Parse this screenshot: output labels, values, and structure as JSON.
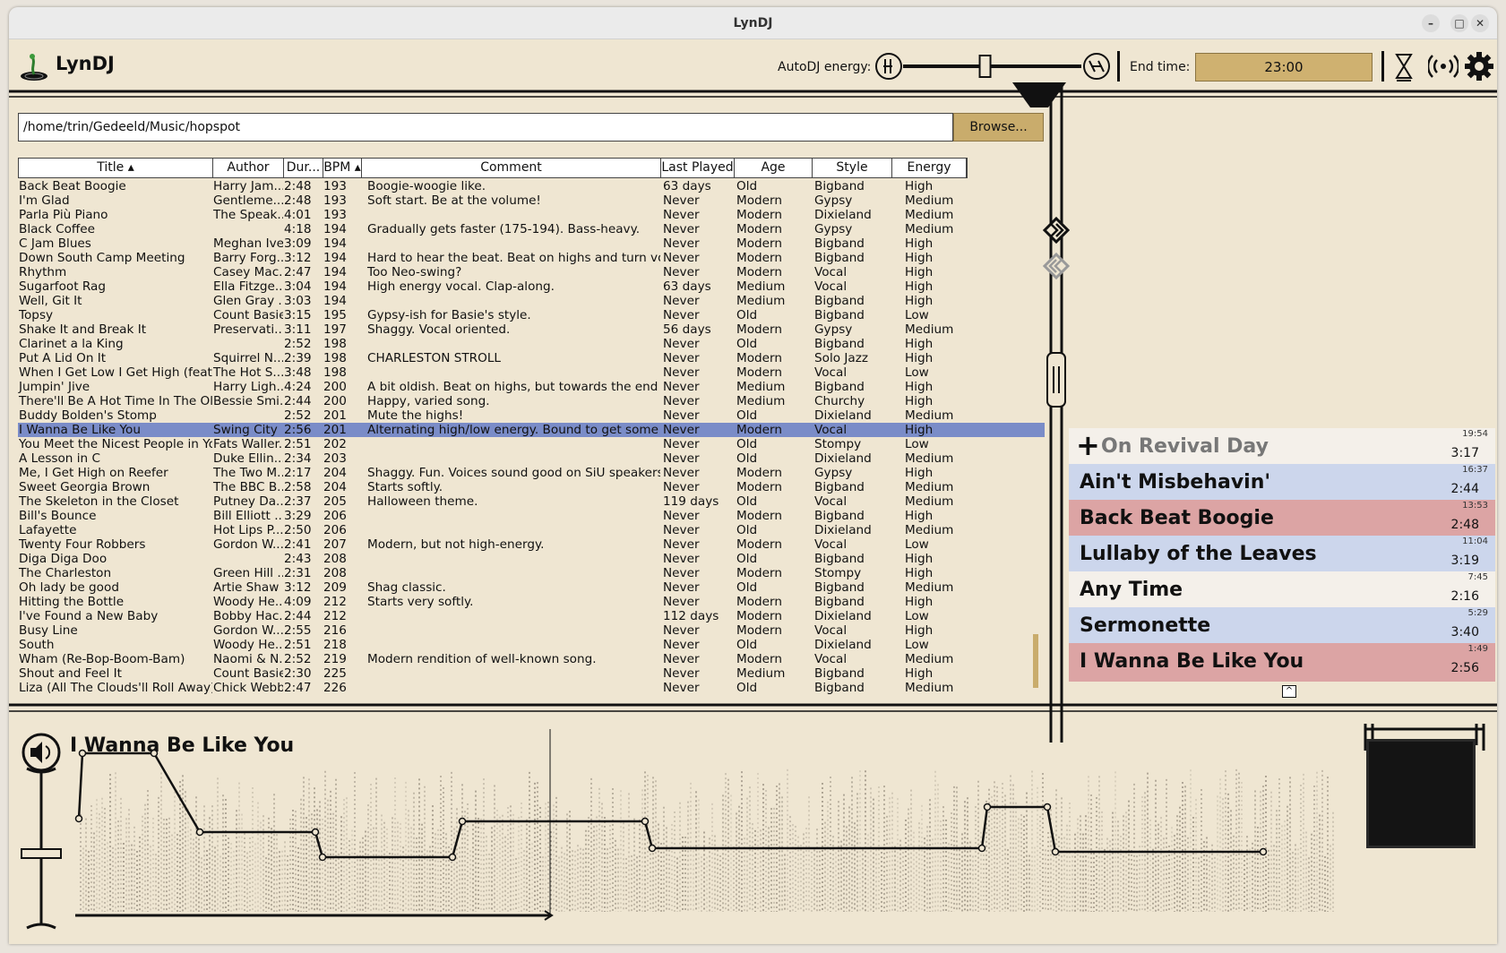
{
  "window": {
    "title": "LynDJ"
  },
  "toolbar": {
    "app_name": "LynDJ",
    "energy_label": "AutoDJ energy:",
    "energy_value": 0.46,
    "end_time_label": "End time:",
    "end_time": "23:00"
  },
  "browser": {
    "path": "/home/trin/Gedeeld/Music/hopspot",
    "browse_label": "Browse..."
  },
  "table": {
    "columns": [
      "Title ▴",
      "Author",
      "Dur...",
      "BPM ▴",
      "Comment",
      "Last Played",
      "Age",
      "Style",
      "Energy"
    ],
    "rows": [
      [
        "Back Beat Boogie",
        "Harry Jam...",
        "2:48",
        "193",
        "Boogie-woogie like.",
        "63 days",
        "Old",
        "Bigband",
        "High"
      ],
      [
        "I'm Glad",
        "Gentleme...",
        "2:48",
        "193",
        "Soft start. Be at the volume!",
        "Never",
        "Modern",
        "Gypsy",
        "Medium"
      ],
      [
        "Parla Più Piano",
        "The Speak...",
        "4:01",
        "193",
        "",
        "Never",
        "Modern",
        "Dixieland",
        "Medium"
      ],
      [
        "Black Coffee",
        "",
        "4:18",
        "194",
        "Gradually gets faster (175-194). Bass-heavy.",
        "Never",
        "Modern",
        "Gypsy",
        "Medium"
      ],
      [
        "C Jam Blues",
        "Meghan Ivey",
        "3:09",
        "194",
        "",
        "Never",
        "Modern",
        "Bigband",
        "High"
      ],
      [
        "Down South Camp Meeting",
        "Barry Forg...",
        "3:12",
        "194",
        "Hard to hear the beat. Beat on highs and turn volum...",
        "Never",
        "Modern",
        "Bigband",
        "High"
      ],
      [
        "Rhythm",
        "Casey Mac...",
        "2:47",
        "194",
        "Too Neo-swing?",
        "Never",
        "Modern",
        "Vocal",
        "High"
      ],
      [
        "Sugarfoot Rag",
        "Ella Fitzge...",
        "3:04",
        "194",
        "High energy vocal. Clap-along.",
        "63 days",
        "Medium",
        "Vocal",
        "High"
      ],
      [
        "Well, Git It",
        "Glen Gray ...",
        "3:03",
        "194",
        "",
        "Never",
        "Medium",
        "Bigband",
        "High"
      ],
      [
        "Topsy",
        "Count Basie",
        "3:15",
        "195",
        "Gypsy-ish for Basie's style.",
        "Never",
        "Old",
        "Bigband",
        "Low"
      ],
      [
        "Shake It and Break It",
        "Preservati...",
        "3:11",
        "197",
        "Shaggy. Vocal oriented.",
        "56 days",
        "Modern",
        "Gypsy",
        "Medium"
      ],
      [
        "Clarinet a la King",
        "",
        "2:52",
        "198",
        "",
        "Never",
        "Old",
        "Bigband",
        "High"
      ],
      [
        "Put A Lid On It",
        "Squirrel N...",
        "2:39",
        "198",
        "CHARLESTON STROLL",
        "Never",
        "Modern",
        "Solo Jazz",
        "High"
      ],
      [
        "When I Get Low I Get High (feat. ...",
        "The Hot S...",
        "3:48",
        "198",
        "",
        "Never",
        "Modern",
        "Vocal",
        "Low"
      ],
      [
        "Jumpin' Jive",
        "Harry Ligh...",
        "4:24",
        "200",
        "A bit oldish. Beat on highs, but towards the end the ...",
        "Never",
        "Medium",
        "Bigband",
        "High"
      ],
      [
        "There'll Be A Hot Time In The Old ...",
        "Bessie Smi...",
        "2:44",
        "200",
        "Happy, varied song.",
        "Never",
        "Medium",
        "Churchy",
        "High"
      ],
      [
        "Buddy Bolden's Stomp",
        "",
        "2:52",
        "201",
        "Mute the highs!",
        "Never",
        "Old",
        "Dixieland",
        "Medium"
      ],
      [
        "I Wanna Be Like You",
        "Swing City",
        "2:56",
        "201",
        "Alternating high/low energy. Bound to get some smil...",
        "Never",
        "Modern",
        "Vocal",
        "High"
      ],
      [
        "You Meet the Nicest People in You...",
        "Fats Waller...",
        "2:51",
        "202",
        "",
        "Never",
        "Old",
        "Stompy",
        "Low"
      ],
      [
        "A Lesson in C",
        "Duke Ellin...",
        "2:34",
        "203",
        "",
        "Never",
        "Old",
        "Dixieland",
        "Medium"
      ],
      [
        "Me, I Get High on Reefer",
        "The Two M...",
        "2:17",
        "204",
        "Shaggy. Fun. Voices sound good on SiU speakers.",
        "Never",
        "Modern",
        "Gypsy",
        "High"
      ],
      [
        "Sweet Georgia Brown",
        "The BBC B...",
        "2:58",
        "204",
        "Starts softly.",
        "Never",
        "Modern",
        "Bigband",
        "Medium"
      ],
      [
        "The Skeleton in the Closet",
        "Putney Da...",
        "2:37",
        "205",
        "Halloween theme.",
        "119 days",
        "Old",
        "Vocal",
        "Medium"
      ],
      [
        "Bill's Bounce",
        "Bill Elliott ...",
        "3:29",
        "206",
        "",
        "Never",
        "Modern",
        "Bigband",
        "High"
      ],
      [
        "Lafayette",
        "Hot Lips P...",
        "2:50",
        "206",
        "",
        "Never",
        "Old",
        "Dixieland",
        "Medium"
      ],
      [
        "Twenty Four Robbers",
        "Gordon W...",
        "2:41",
        "207",
        "Modern, but not high-energy.",
        "Never",
        "Modern",
        "Vocal",
        "Low"
      ],
      [
        "Diga Diga Doo",
        "",
        "2:43",
        "208",
        "",
        "Never",
        "Old",
        "Bigband",
        "High"
      ],
      [
        "The Charleston",
        "Green Hill ...",
        "2:31",
        "208",
        "",
        "Never",
        "Modern",
        "Stompy",
        "High"
      ],
      [
        "Oh  lady  be good",
        "Artie Shaw",
        "3:12",
        "209",
        "Shag classic.",
        "Never",
        "Old",
        "Bigband",
        "Medium"
      ],
      [
        "Hitting the Bottle",
        "Woody He...",
        "4:09",
        "212",
        "Starts very softly.",
        "Never",
        "Modern",
        "Bigband",
        "High"
      ],
      [
        "I've Found a New Baby",
        "Bobby Hac...",
        "2:44",
        "212",
        "",
        "112 days",
        "Modern",
        "Dixieland",
        "Low"
      ],
      [
        "Busy Line",
        "Gordon W...",
        "2:55",
        "216",
        "",
        "Never",
        "Modern",
        "Vocal",
        "High"
      ],
      [
        "South",
        "Woody He...",
        "2:51",
        "218",
        "",
        "Never",
        "Old",
        "Dixieland",
        "Low"
      ],
      [
        "Wham (Re-Bop-Boom-Bam)",
        "Naomi & N...",
        "2:52",
        "219",
        "Modern rendition of well-known song.",
        "Never",
        "Modern",
        "Vocal",
        "Medium"
      ],
      [
        "Shout and Feel It",
        "Count Basie",
        "2:30",
        "225",
        "",
        "Never",
        "Medium",
        "Bigband",
        "High"
      ],
      [
        "Liza (All The Clouds'll Roll Away)",
        "Chick Webb",
        "2:47",
        "226",
        "",
        "Never",
        "Old",
        "Bigband",
        "Medium"
      ]
    ],
    "selected_index": 17
  },
  "queue": [
    {
      "title": "On Revival Day",
      "duration": "3:17",
      "time": "19:54",
      "color": "#f4f0ea",
      "pending": true
    },
    {
      "title": "Ain't Misbehavin'",
      "duration": "2:44",
      "time": "16:37",
      "color": "#ccd6ec"
    },
    {
      "title": "Back Beat Boogie",
      "duration": "2:48",
      "time": "13:53",
      "color": "#dca4a4"
    },
    {
      "title": "Lullaby of the Leaves",
      "duration": "3:19",
      "time": "11:04",
      "color": "#ccd6ec"
    },
    {
      "title": "Any Time",
      "duration": "2:16",
      "time": "7:45",
      "color": "#f4f0ea"
    },
    {
      "title": "Sermonette",
      "duration": "3:40",
      "time": "5:29",
      "color": "#ccd6ec"
    },
    {
      "title": "I Wanna Be Like You",
      "duration": "2:56",
      "time": "1:49",
      "color": "#dca4a4"
    }
  ],
  "player": {
    "now_playing": "I Wanna Be Like You",
    "progress": 0.4
  },
  "colors": {
    "accent": "#c9ac6c",
    "background": "#efe6d2",
    "selection": "#7a8cc8"
  },
  "icons": [
    "lyndj-logo-icon",
    "minimize-icon",
    "maximize-icon",
    "close-icon",
    "calm-energy-icon",
    "wild-energy-icon",
    "hourglass-icon",
    "broadcast-icon",
    "gear-icon",
    "forward-icon",
    "back-icon",
    "volume-icon"
  ]
}
